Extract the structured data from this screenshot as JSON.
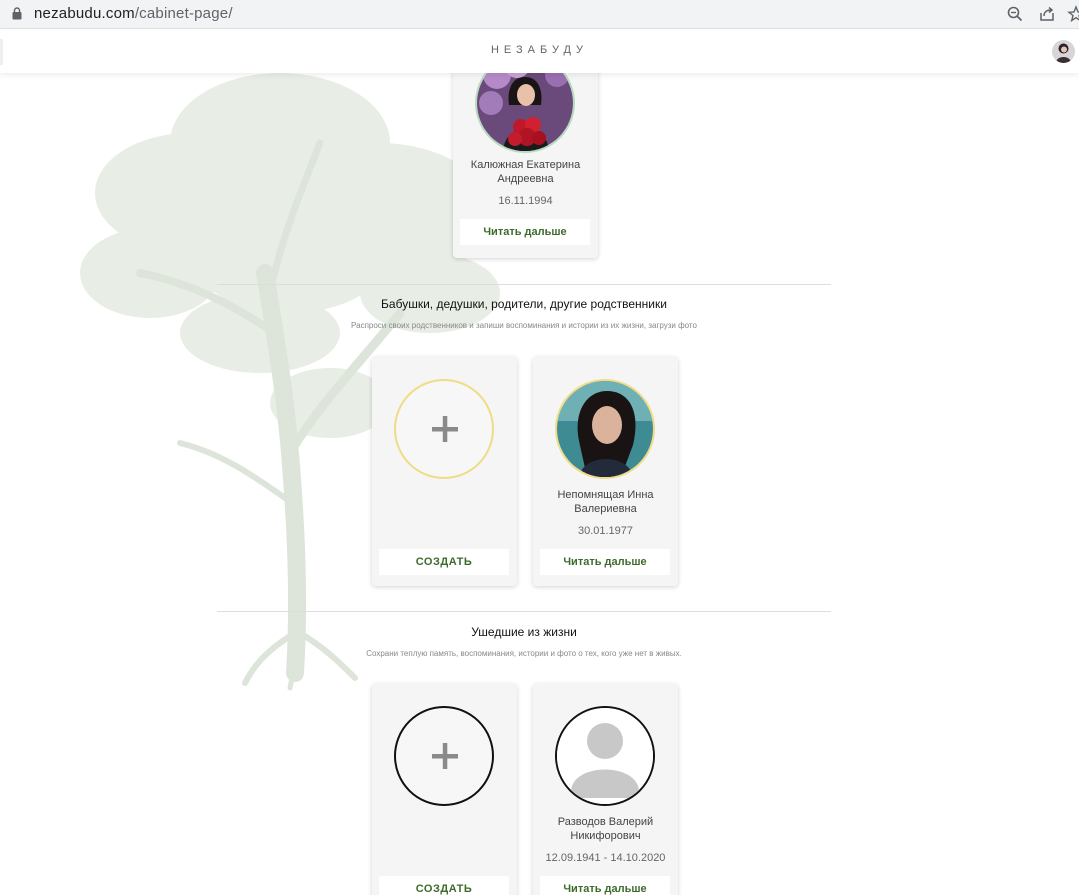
{
  "browser": {
    "url_domain": "nezabudu.com",
    "url_path": "/cabinet-page/",
    "icons": [
      "lock-icon",
      "zoom-icon",
      "share-icon",
      "bookmark-star-icon"
    ]
  },
  "header": {
    "logo": "НЕЗАБУДУ",
    "avatar_icon": "user-avatar"
  },
  "top_card": {
    "name": "Калюжная  Екатерина\nАндреевна",
    "date": "16.11.1994",
    "button": "Читать дальше"
  },
  "relatives": {
    "title": "Бабушки, дедушки, родители, другие родственники",
    "subtitle": "Распроси своих родственников и запиши воспоминания и истории из их жизни, загрузи фото",
    "create_button": "СОЗДАТЬ",
    "person": {
      "name": "Непомнящая  Инна\nВалериевна",
      "date": "30.01.1977",
      "button": "Читать дальше"
    },
    "ring_color": "#f0dc84"
  },
  "departed": {
    "title": "Ушедшие из жизни",
    "subtitle": "Сохрани теплую память, воспоминания, истории и фото о тех, кого уже нет в живых.",
    "create_button": "СОЗДАТЬ",
    "person": {
      "name": "Разводов  Валерий\nНикифорович",
      "date": "12.09.1941 - 14.10.2020",
      "button": "Читать дальше"
    },
    "ring_color": "#111111"
  },
  "colors": {
    "accent_green": "#3d6b2c",
    "card_bg": "#f5f5f5",
    "tree": "#e6ece4"
  }
}
